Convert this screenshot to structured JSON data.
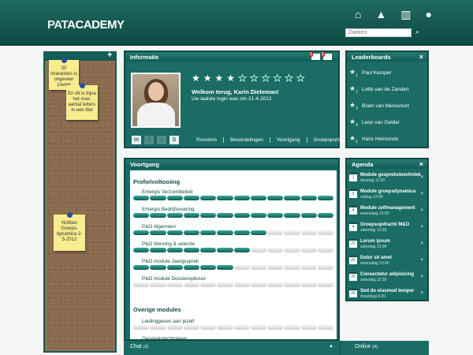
{
  "header": {
    "logo_part1": "PAT",
    "logo_part2": "ACADEMY",
    "search_placeholder": "Zoeken",
    "icons": [
      "home-icon",
      "graduation-cap-icon",
      "book-icon",
      "user-icon"
    ]
  },
  "notes": [
    {
      "text": "30 characters is ongeveer zoveel"
    },
    {
      "text": "En dit is bijna het max. aantal letters in een titel"
    },
    {
      "text": "Notities Groeps-dynamica 2-5-2012"
    }
  ],
  "info": {
    "title": "Informatie",
    "badge1": "1",
    "badge2": "1",
    "rating": 4,
    "rating_max": 10,
    "welcome": "Welkom terug, Karin Dieleman!",
    "last_login": "Uw laatste login was om 21-4-2012",
    "social": [
      "in",
      "f",
      "t",
      "S"
    ],
    "links": [
      "Roosters",
      "Beoordelingen",
      "Voortgang",
      "Groepsportaal"
    ]
  },
  "leaderboards": {
    "title": "Leaderboards",
    "items": [
      {
        "rank": "1",
        "name": "Paul Kemper"
      },
      {
        "rank": "2",
        "name": "Lotte van de Zanden"
      },
      {
        "rank": "3",
        "name": "Bram van Mensvoort"
      },
      {
        "rank": "4",
        "name": "Leon van Gelder"
      },
      {
        "rank": "5",
        "name": "Hans Helmonds"
      }
    ]
  },
  "voortgang": {
    "title": "Voortgang",
    "section1": "Profielvoltooiing",
    "items": [
      {
        "label": "Emergis Verzuimbeleid",
        "progress": 1.0
      },
      {
        "label": "Emergis Bedrijfsvoering",
        "progress": 1.0
      },
      {
        "label": "P&O Algemeen",
        "progress": 0.7
      },
      {
        "label": "P&O Werving & selectie",
        "progress": 0.6
      },
      {
        "label": "P&O module Jaargesprek",
        "progress": 0.5
      },
      {
        "label": "P&O module Dossieropbouw",
        "progress": 0.0
      }
    ],
    "section2": "Overige modules",
    "other": [
      {
        "label": "Leidinggeven aan jezelf",
        "progress": 0.0
      },
      {
        "label": "Gesprekstechnieken",
        "progress": 0.0
      }
    ]
  },
  "agenda": {
    "title": "Agenda",
    "items": [
      {
        "day": "1",
        "title": "Module gespreksteechniek",
        "date": "dinsdag 11:00"
      },
      {
        "day": "3",
        "title": "Module groepsdynamica",
        "date": "vrijdag 13:00"
      },
      {
        "day": "4",
        "title": "Module zelfmanagement",
        "date": "woensdag 15:00"
      },
      {
        "day": "4",
        "title": "Groepsopdracht M&O",
        "date": "zaterdag 12:30"
      },
      {
        "day": "21",
        "title": "Lorum ipsum",
        "date": "zaterdag 13:00"
      },
      {
        "day": "26",
        "title": "Dolor sit amet",
        "date": "woensdag 13:00"
      },
      {
        "day": "25",
        "title": "Consectetur adipisicing",
        "date": "zaterdag 12:30"
      },
      {
        "day": "26",
        "title": "Sed do eiusmod tempor",
        "date": "maandag 9:30"
      }
    ]
  },
  "bottom": {
    "chat_label": "Chat",
    "chat_count": "(2)",
    "online_label": "Online",
    "online_count": "(4)"
  }
}
